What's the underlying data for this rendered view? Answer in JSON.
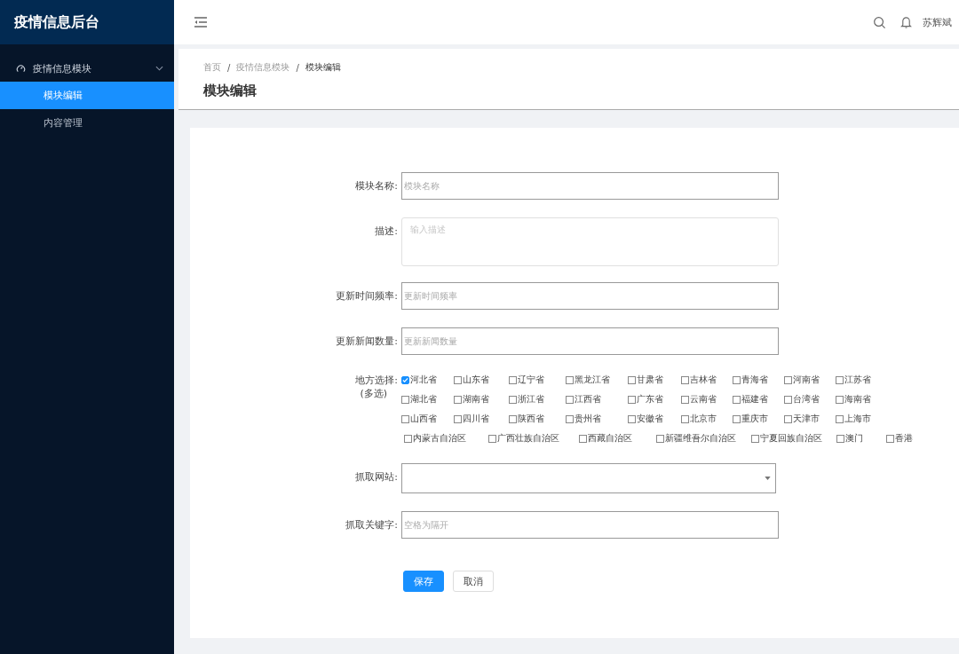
{
  "sidebar": {
    "title": "疫情信息后台",
    "groups": [
      {
        "label": "疫情信息模块",
        "expanded": true,
        "children": [
          {
            "label": "模块编辑",
            "selected": true
          },
          {
            "label": "内容管理",
            "selected": false
          }
        ]
      }
    ]
  },
  "header": {
    "user": "苏辉斌"
  },
  "breadcrumb": [
    {
      "label": "首页",
      "current": false
    },
    {
      "separator": "/",
      "label": "疫情信息模块",
      "current": false
    },
    {
      "separator": "/",
      "label": "模块编辑",
      "current": true
    }
  ],
  "page_title": "模块编辑",
  "form": {
    "fields": [
      {
        "kind": "input",
        "label": "模块名称:",
        "placeholder": "模块名称"
      },
      {
        "kind": "textarea",
        "label": "描述:",
        "placeholder": "输入描述"
      },
      {
        "kind": "input",
        "label": "更新时间频率:",
        "placeholder": "更新时间频率"
      },
      {
        "kind": "input",
        "label": "更新新闻数量:",
        "placeholder": "更新新闻数量"
      },
      {
        "kind": "checkboxes",
        "label": "地方选择:",
        "sublabel": "(多选)",
        "rows": [
          {
            "kind": "grid",
            "items": [
              {
                "label": "河北省",
                "checked": true
              },
              {
                "label": "山东省",
                "checked": false
              },
              {
                "label": "辽宁省",
                "checked": false
              },
              {
                "label": "黑龙江省",
                "checked": false
              },
              {
                "label": "甘肃省",
                "checked": false
              },
              {
                "label": "吉林省",
                "checked": false
              },
              {
                "label": "青海省",
                "checked": false
              },
              {
                "label": "河南省",
                "checked": false
              },
              {
                "label": "江苏省",
                "checked": false
              }
            ]
          },
          {
            "kind": "grid",
            "items": [
              {
                "label": "湖北省",
                "checked": false
              },
              {
                "label": "湖南省",
                "checked": false
              },
              {
                "label": "浙江省",
                "checked": false
              },
              {
                "label": "江西省",
                "checked": false
              },
              {
                "label": "广东省",
                "checked": false
              },
              {
                "label": "云南省",
                "checked": false
              },
              {
                "label": "福建省",
                "checked": false
              },
              {
                "label": "台湾省",
                "checked": false
              },
              {
                "label": "海南省",
                "checked": false
              }
            ]
          },
          {
            "kind": "grid",
            "items": [
              {
                "label": "山西省",
                "checked": false
              },
              {
                "label": "四川省",
                "checked": false
              },
              {
                "label": "陕西省",
                "checked": false
              },
              {
                "label": "贵州省",
                "checked": false
              },
              {
                "label": "安徽省",
                "checked": false
              },
              {
                "label": "北京市",
                "checked": false
              },
              {
                "label": "重庆市",
                "checked": false
              },
              {
                "label": "天津市",
                "checked": false
              },
              {
                "label": "上海市",
                "checked": false
              }
            ]
          },
          {
            "kind": "wide",
            "items": [
              {
                "label": "内蒙古自治区",
                "checked": false
              },
              {
                "label": "广西壮族自治区",
                "checked": false
              },
              {
                "label": "西藏自治区",
                "checked": false
              },
              {
                "label": "新疆维吾尔自治区",
                "checked": false
              },
              {
                "label": "宁夏回族自治区",
                "checked": false
              },
              {
                "label": "澳门",
                "checked": false
              },
              {
                "label": "香港",
                "checked": false
              }
            ]
          }
        ]
      },
      {
        "kind": "select",
        "label": "抓取网站:"
      },
      {
        "kind": "input",
        "label": "抓取关键字:",
        "placeholder": "空格为隔开"
      }
    ],
    "buttons": [
      {
        "label": "保存",
        "kind": "primary"
      },
      {
        "label": "取消",
        "kind": "default"
      }
    ]
  }
}
